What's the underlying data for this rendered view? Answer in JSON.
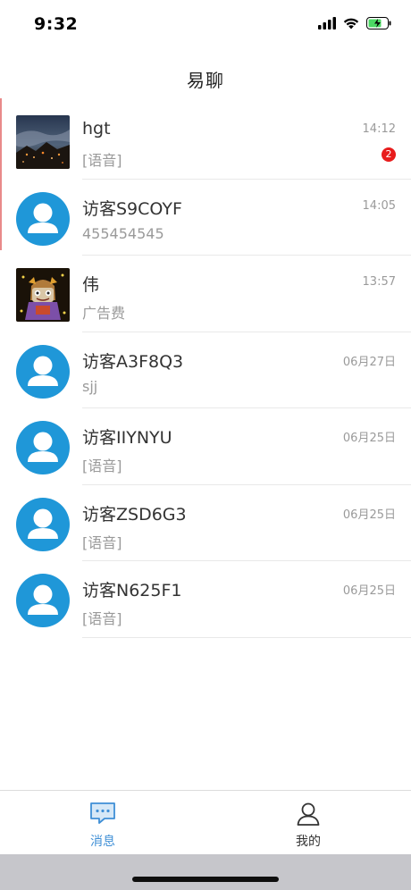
{
  "status_bar": {
    "time": "9:32",
    "icons": [
      "cellular-signal-icon",
      "wifi-icon",
      "battery-charging-icon"
    ],
    "battery_color": "#4cd964"
  },
  "header": {
    "title": "易聊"
  },
  "conversations": [
    {
      "name": "hgt",
      "preview": "[语音]",
      "time": "14:12",
      "unread": "2",
      "avatar": "photo-night-sky"
    },
    {
      "name": "访客S9COYF",
      "preview": "455454545",
      "time": "14:05",
      "avatar": "default-user"
    },
    {
      "name": "伟",
      "preview": "广告费",
      "time": "13:57",
      "avatar": "photo-cartoon"
    },
    {
      "name": "访客A3F8Q3",
      "preview": "sjj",
      "time": "06月27日",
      "avatar": "default-user"
    },
    {
      "name": "访客IIYNYU",
      "preview": "[语音]",
      "time": "06月25日",
      "avatar": "default-user"
    },
    {
      "name": "访客ZSD6G3",
      "preview": "[语音]",
      "time": "06月25日",
      "avatar": "default-user"
    },
    {
      "name": "访客N625F1",
      "preview": "[语音]",
      "time": "06月25日",
      "avatar": "default-user"
    }
  ],
  "tab_bar": {
    "tabs": [
      {
        "label": "消息",
        "icon": "chat-bubble-icon",
        "active": true
      },
      {
        "label": "我的",
        "icon": "user-profile-icon",
        "active": false
      }
    ]
  },
  "colors": {
    "accent": "#3f8fd6",
    "avatar_default": "#1f97d8",
    "badge": "#e81c1c"
  }
}
